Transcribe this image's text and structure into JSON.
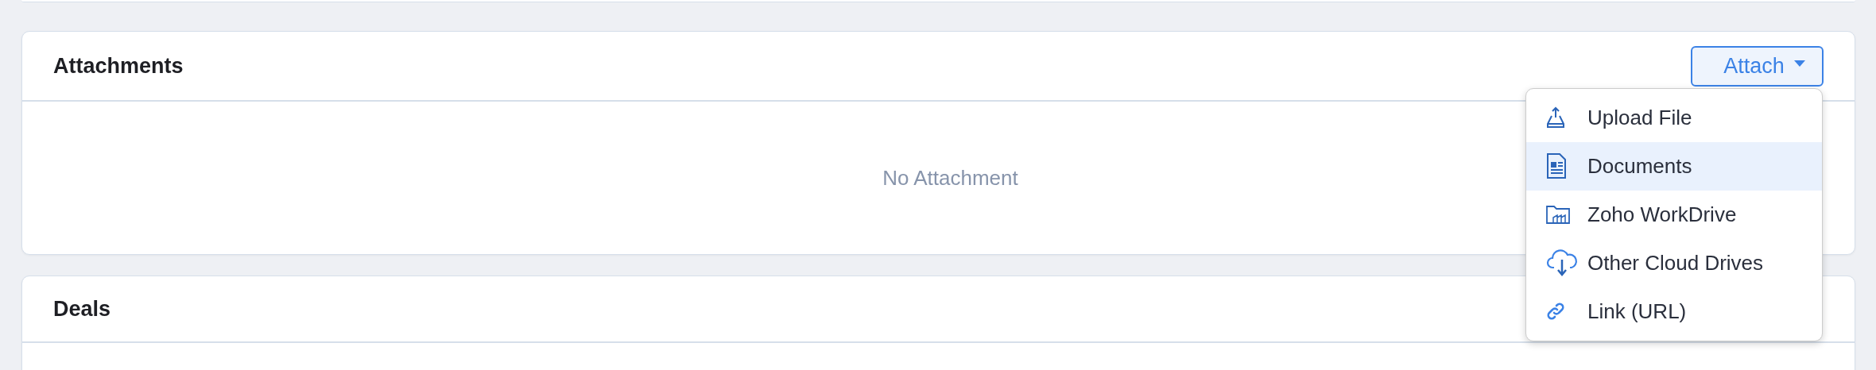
{
  "attachments": {
    "title": "Attachments",
    "attach_button": {
      "label": "Attach",
      "expanded": true
    },
    "empty_message": "No Attachment",
    "menu": [
      {
        "kind": "upload",
        "label": "Upload File",
        "selected": false
      },
      {
        "kind": "document",
        "label": "Documents",
        "selected": true
      },
      {
        "kind": "folder",
        "label": "Zoho WorkDrive",
        "selected": false
      },
      {
        "kind": "cloud",
        "label": "Other Cloud Drives",
        "selected": false
      },
      {
        "kind": "link",
        "label": "Link (URL)",
        "selected": false
      }
    ]
  },
  "deals": {
    "title": "Deals"
  }
}
